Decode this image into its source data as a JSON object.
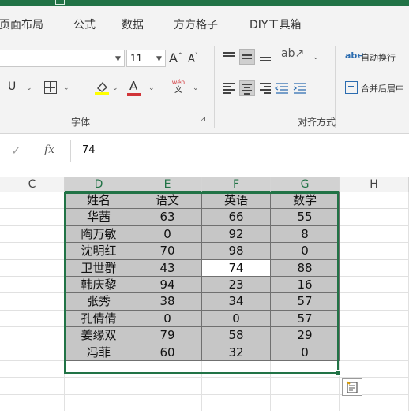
{
  "ribbon_tabs": [
    "页面布局",
    "公式",
    "数据",
    "方方格子",
    "DIY工具箱"
  ],
  "font_group": {
    "font_size": "11",
    "grow_label": "A",
    "shrink_label": "A",
    "underline_label": "U",
    "font_color_label": "A",
    "phonetic_top": "wén",
    "phonetic_bottom": "文",
    "group_label": "字体"
  },
  "alignment_group": {
    "wrap_text_label": "自动换行",
    "merge_center_label": "合并后居中",
    "group_label": "对齐方式"
  },
  "formula_bar": {
    "fx_label": "fx",
    "value": "74"
  },
  "columns": [
    "C",
    "D",
    "E",
    "F",
    "G",
    "H"
  ],
  "table": {
    "headers": [
      "姓名",
      "语文",
      "英语",
      "数学"
    ],
    "rows": [
      [
        "华茜",
        "63",
        "66",
        "55"
      ],
      [
        "陶万敏",
        "0",
        "92",
        "8"
      ],
      [
        "沈明红",
        "70",
        "98",
        "0"
      ],
      [
        "卫世群",
        "43",
        "74",
        "88"
      ],
      [
        "韩庆黎",
        "94",
        "23",
        "16"
      ],
      [
        "张秀",
        "38",
        "34",
        "57"
      ],
      [
        "孔倩倩",
        "0",
        "0",
        "57"
      ],
      [
        "姜缘双",
        "79",
        "58",
        "29"
      ],
      [
        "冯菲",
        "60",
        "32",
        "0"
      ]
    ]
  },
  "colors": {
    "accent": "#217346",
    "selection_fill": "#c6c6c6",
    "font_color_bar": "#d13438",
    "highlight_bar": "#ffff00"
  }
}
